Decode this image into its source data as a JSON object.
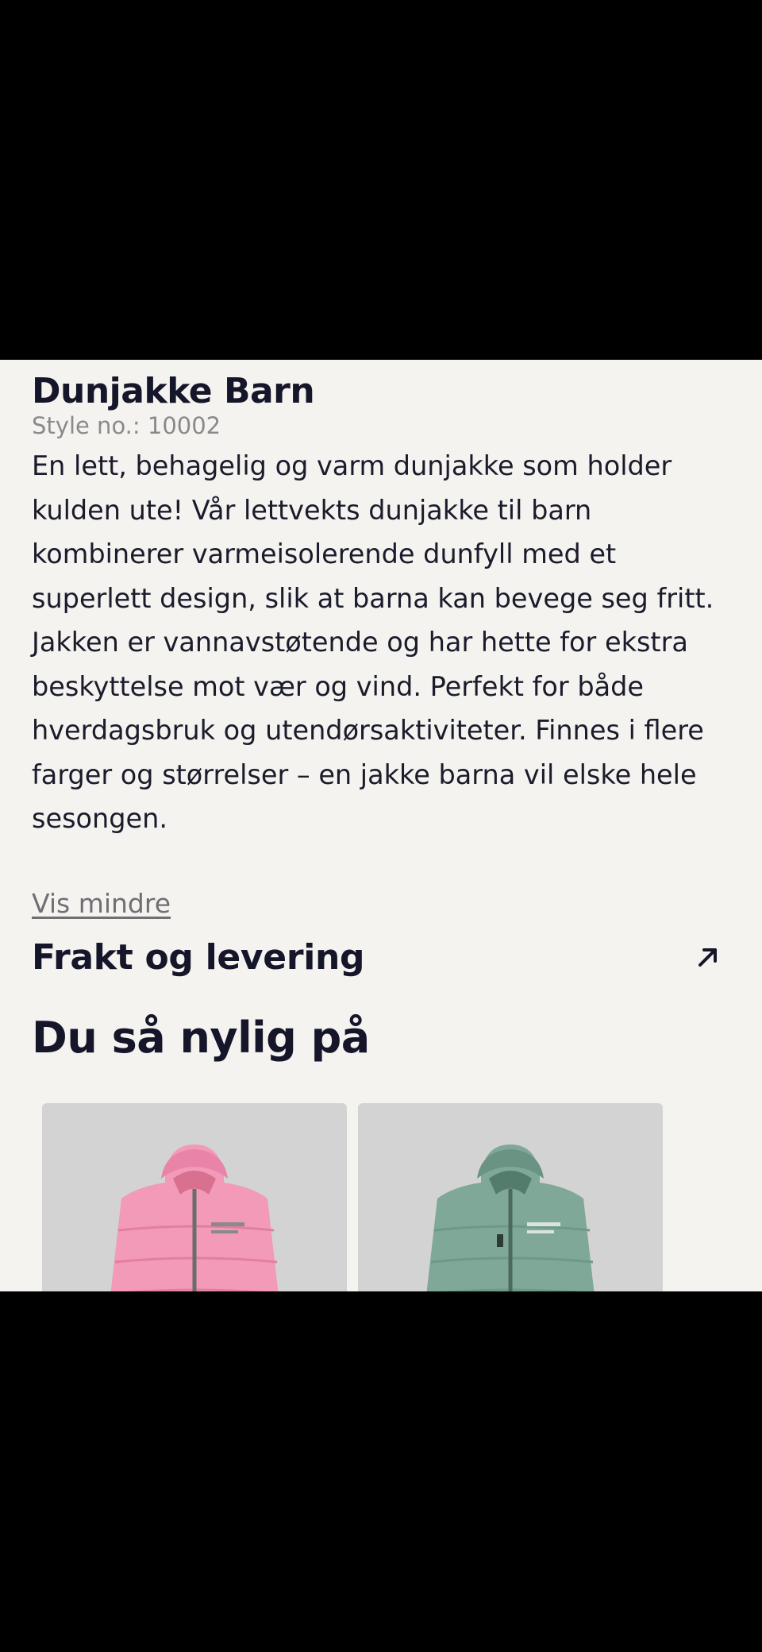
{
  "product": {
    "title": "Dunjakke Barn",
    "style_no": "Style no.: 10002",
    "description": "En lett, behagelig og varm dunjakke som holder kulden ute! Vår lettvekts dunjakke til barn kombinerer varmeisolerende dunfyll med et superlett design, slik at barna kan bevege seg fritt. Jakken er vannavstøtende og har hette for ekstra beskyttelse mot vær og vind. Perfekt for både hverdagsbruk og utendørsaktiviteter. Finnes i flere farger og størrelser – en jakke barna vil elske hele sesongen.",
    "toggle_label": "Vis mindre"
  },
  "shipping": {
    "label": "Frakt og levering",
    "icon": "arrow-up-right-icon"
  },
  "recently_viewed": {
    "heading": "Du så nylig på",
    "items": [
      {
        "color_name": "pink",
        "jacket_color": "#f29ab8",
        "card_bg": "#d3d3d3"
      },
      {
        "color_name": "mint",
        "jacket_color": "#7fa898",
        "card_bg": "#d3d3d3"
      }
    ]
  },
  "colors": {
    "panel_bg": "#f4f3f0",
    "text_primary": "#16162a",
    "text_muted": "#8a8a8e"
  }
}
